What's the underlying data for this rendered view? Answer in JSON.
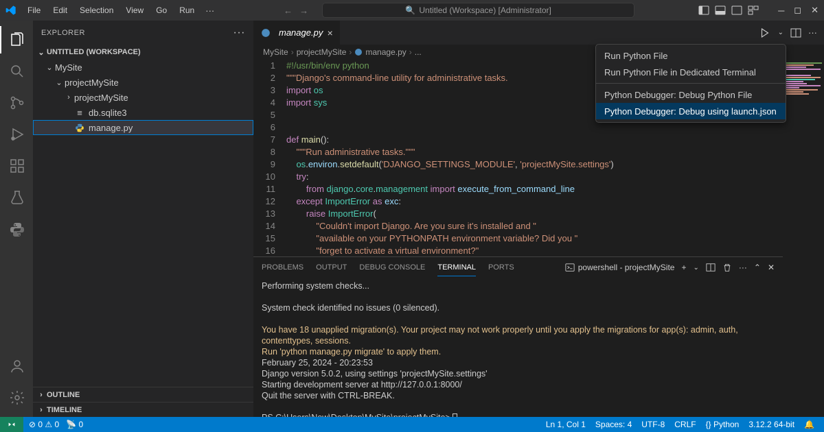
{
  "titlebar": {
    "menu": [
      "File",
      "Edit",
      "Selection",
      "View",
      "Go",
      "Run"
    ],
    "search_placeholder": "Untitled (Workspace) [Administrator]"
  },
  "activitybar": {
    "items": [
      "explorer",
      "search",
      "source-control",
      "run-debug",
      "extensions",
      "testing",
      "python-env"
    ]
  },
  "explorer": {
    "title": "EXPLORER",
    "workspace": "UNTITLED (WORKSPACE)",
    "tree": [
      {
        "label": "MySite",
        "depth": 1,
        "kind": "folder",
        "open": true
      },
      {
        "label": "projectMySite",
        "depth": 2,
        "kind": "folder",
        "open": true
      },
      {
        "label": "projectMySite",
        "depth": 3,
        "kind": "folder",
        "open": false
      },
      {
        "label": "db.sqlite3",
        "depth": 3,
        "kind": "db"
      },
      {
        "label": "manage.py",
        "depth": 3,
        "kind": "py",
        "selected": true
      }
    ],
    "sections": [
      "OUTLINE",
      "TIMELINE"
    ]
  },
  "editor": {
    "tab_label": "manage.py",
    "breadcrumb": [
      "MySite",
      "projectMySite",
      "manage.py",
      "..."
    ],
    "run_menu": [
      {
        "label": "Run Python File"
      },
      {
        "label": "Run Python File in Dedicated Terminal"
      },
      {
        "sep": true
      },
      {
        "label": "Python Debugger: Debug Python File"
      },
      {
        "label": "Python Debugger: Debug using launch.json",
        "highlighted": true
      }
    ],
    "code": [
      {
        "n": 1,
        "html": "<span class='tok-comment'>#!/usr/bin/env python</span>"
      },
      {
        "n": 2,
        "html": "<span class='tok-str'>\"\"\"Django's command-line utility for administrative tasks.</span>"
      },
      {
        "n": 3,
        "html": "<span class='tok-keyword'>import</span> <span class='tok-mod'>os</span>"
      },
      {
        "n": 4,
        "html": "<span class='tok-keyword'>import</span> <span class='tok-mod'>sys</span>"
      },
      {
        "n": 5,
        "html": ""
      },
      {
        "n": 6,
        "html": ""
      },
      {
        "n": 7,
        "html": "<span class='tok-keyword'>def</span> <span class='tok-func'>main</span>():"
      },
      {
        "n": 8,
        "html": "    <span class='tok-str'>\"\"\"Run administrative tasks.\"\"\"</span>"
      },
      {
        "n": 9,
        "html": "    <span class='tok-mod'>os</span>.<span class='tok-var'>environ</span>.<span class='tok-func'>setdefault</span>(<span class='tok-str'>'DJANGO_SETTINGS_MODULE'</span>, <span class='tok-str'>'projectMySite.settings'</span>)"
      },
      {
        "n": 10,
        "html": "    <span class='tok-keyword'>try</span>:"
      },
      {
        "n": 11,
        "html": "        <span class='tok-keyword'>from</span> <span class='tok-mod'>django</span>.<span class='tok-mod'>core</span>.<span class='tok-mod'>management</span> <span class='tok-keyword'>import</span> <span class='tok-var'>execute_from_command_line</span>"
      },
      {
        "n": 12,
        "html": "    <span class='tok-keyword'>except</span> <span class='tok-builtin'>ImportError</span> <span class='tok-keyword'>as</span> <span class='tok-var'>exc</span>:"
      },
      {
        "n": 13,
        "html": "        <span class='tok-keyword'>raise</span> <span class='tok-builtin'>ImportError</span>("
      },
      {
        "n": 14,
        "html": "            <span class='tok-str'>\"Couldn't import Django. Are you sure it's installed and \"</span>"
      },
      {
        "n": 15,
        "html": "            <span class='tok-str'>\"available on your PYTHONPATH environment variable? Did you \"</span>"
      },
      {
        "n": 16,
        "html": "            <span class='tok-str'>\"forget to activate a virtual environment?\"</span>"
      }
    ]
  },
  "panel": {
    "tabs": [
      "PROBLEMS",
      "OUTPUT",
      "DEBUG CONSOLE",
      "TERMINAL",
      "PORTS"
    ],
    "active_tab": "TERMINAL",
    "shell_label": "powershell - projectMySite",
    "lines": [
      {
        "text": "Performing system checks..."
      },
      {
        "text": ""
      },
      {
        "text": "System check identified no issues (0 silenced)."
      },
      {
        "text": ""
      },
      {
        "cls": "warn",
        "text": "You have 18 unapplied migration(s). Your project may not work properly until you apply the migrations for app(s): admin, auth, contenttypes, sessions."
      },
      {
        "cls": "warn",
        "text": "Run 'python manage.py migrate' to apply them."
      },
      {
        "text": "February 25, 2024 - 20:23:53"
      },
      {
        "text": "Django version 5.0.2, using settings 'projectMySite.settings'"
      },
      {
        "text": "Starting development server at http://127.0.0.1:8000/"
      },
      {
        "text": "Quit the server with CTRL-BREAK."
      },
      {
        "text": ""
      },
      {
        "prompt": true,
        "text": "PS C:\\Users\\New\\Desktop\\MySite\\projectMySite> "
      }
    ]
  },
  "statusbar": {
    "left": [
      "⊘ 0 ⚠ 0",
      "📡 0"
    ],
    "right": [
      "Ln 1, Col 1",
      "Spaces: 4",
      "UTF-8",
      "CRLF",
      "{} Python",
      "3.12.2 64-bit",
      "🔔"
    ]
  }
}
